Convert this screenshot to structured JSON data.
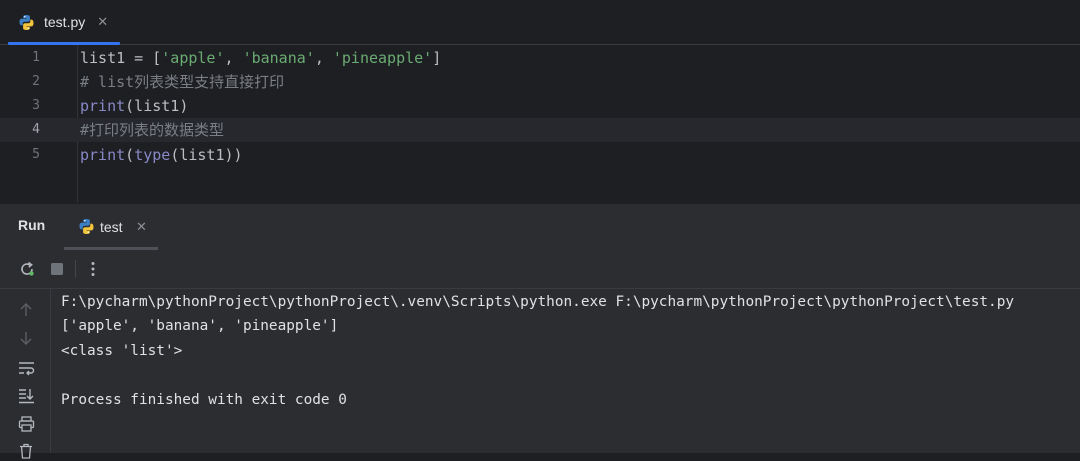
{
  "editor": {
    "tab_label": "test.py",
    "tab_close": "✕",
    "lines": [
      {
        "number": "1",
        "tokens": [
          "list1 = [",
          "'apple'",
          ", ",
          "'banana'",
          ", ",
          "'pineapple'",
          "]"
        ]
      },
      {
        "number": "2",
        "comment": "# list列表类型支持直接打印"
      },
      {
        "number": "3",
        "keyword": "print",
        "rest": "(list1)"
      },
      {
        "number": "4",
        "comment": "#打印列表的数据类型"
      },
      {
        "number": "5",
        "keyword": "print",
        "mid": "(",
        "keyword2": "type",
        "rest": "(list1))"
      }
    ]
  },
  "run": {
    "title": "Run",
    "tab_label": "test",
    "tab_close": "✕",
    "console_lines": [
      "F:\\pycharm\\pythonProject\\pythonProject\\.venv\\Scripts\\python.exe F:\\pycharm\\pythonProject\\pythonProject\\test.py",
      "['apple', 'banana', 'pineapple']",
      "<class 'list'>",
      "",
      "Process finished with exit code 0"
    ]
  },
  "icons": {
    "rerun": "rerun-icon",
    "stop": "stop-icon",
    "more": "more-vertical-icon",
    "up": "arrow-up-icon",
    "down": "arrow-down-icon",
    "wrap": "soft-wrap-icon",
    "scroll_end": "scroll-to-end-icon",
    "print": "print-icon",
    "delete": "trash-icon"
  },
  "colors": {
    "accent": "#3574f0",
    "string": "#6aab73",
    "keyword": "#8888c6",
    "comment": "#7a7e85"
  }
}
